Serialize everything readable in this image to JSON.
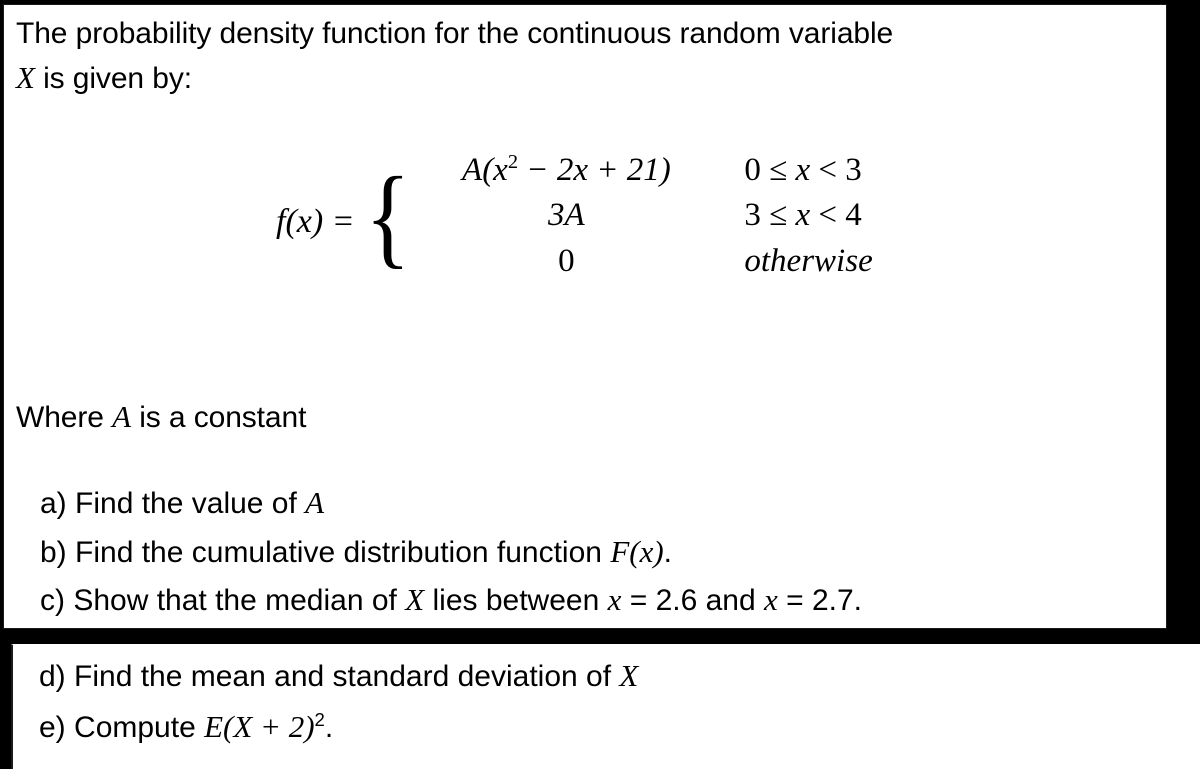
{
  "document": {
    "intro": {
      "line1": "The probability density function for the continuous random variable",
      "variable": "X",
      "line2_rest": " is given by:"
    },
    "formula": {
      "function_label": "f(x) =",
      "brace": "{",
      "cases": [
        {
          "expression": "A(x² − 2x + 21)",
          "expr_head": "A(x",
          "expr_sup": "2",
          "expr_tail": " − 2x + 21)",
          "condition": "0 ≤ x < 3",
          "cond_low": "0",
          "cond_rel1": "≤",
          "cond_var": "x",
          "cond_rel2": "<",
          "cond_high": "3"
        },
        {
          "expression": "3A",
          "expr_head": "3A",
          "expr_sup": "",
          "expr_tail": "",
          "condition": "3 ≤ x < 4",
          "cond_low": "3",
          "cond_rel1": "≤",
          "cond_var": "x",
          "cond_rel2": "<",
          "cond_high": "4"
        },
        {
          "expression": "0",
          "expr_head": "0",
          "expr_sup": "",
          "expr_tail": "",
          "condition": "otherwise",
          "cond_low": "",
          "cond_rel1": "",
          "cond_var": "",
          "cond_rel2": "",
          "cond_high": ""
        }
      ]
    },
    "where_note": {
      "prefix": "Where ",
      "variable": "A",
      "suffix": " is a constant"
    },
    "questions_top": [
      {
        "marker": "a)",
        "text_before": " Find the value of ",
        "symbol": "A",
        "text_after": ""
      },
      {
        "marker": "b)",
        "text_before": " Find the cumulative distribution function ",
        "symbol": "F(x)",
        "text_after": "."
      },
      {
        "marker": "c)",
        "text_before": " Show that the median of ",
        "symbol": "X",
        "text_mid": " lies between ",
        "symbol2": "x",
        "eq1": " = 2.6 and ",
        "symbol3": "x",
        "eq2": " = 2.7."
      }
    ],
    "questions_bottom": [
      {
        "marker": "d)",
        "text_before": " Find the mean and standard deviation of ",
        "symbol": "X",
        "text_after": ""
      },
      {
        "marker": "e)",
        "text_before": " Compute ",
        "symbol": "E(X + 2)",
        "superscript": "2",
        "text_after": "."
      }
    ],
    "colors": {
      "ink": "#000000",
      "paper": "#ffffff",
      "frame": "#000000"
    }
  }
}
